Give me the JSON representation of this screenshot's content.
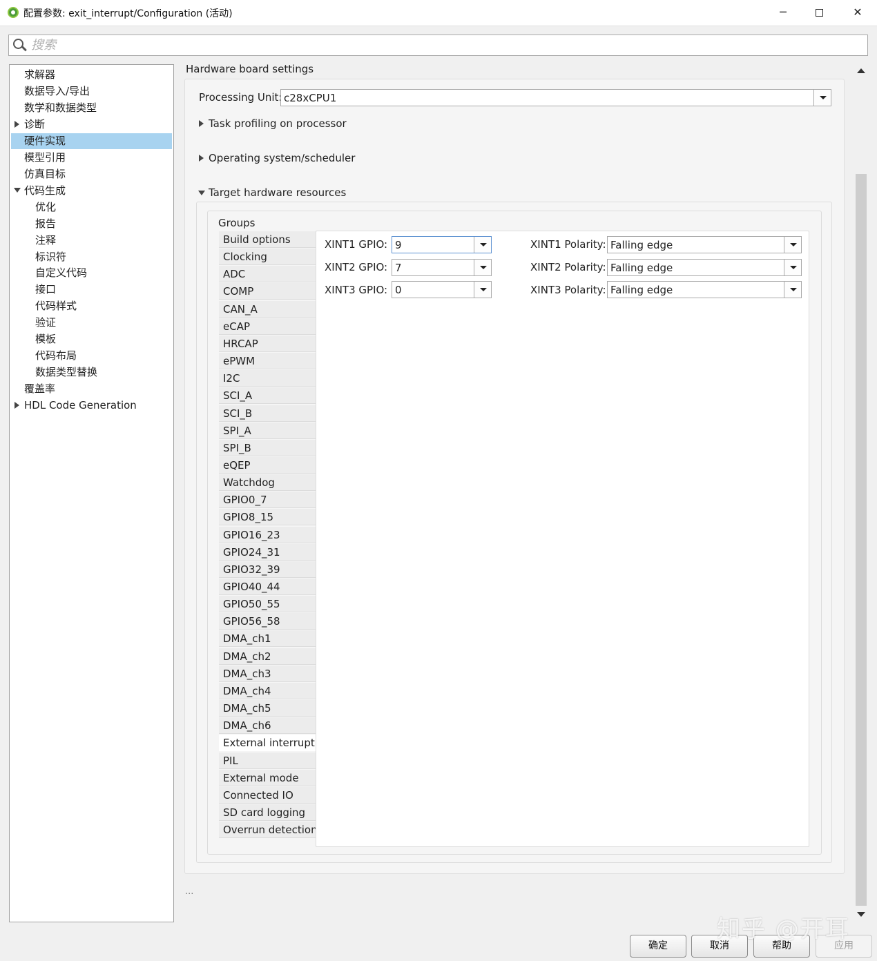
{
  "window": {
    "title": "配置参数: exit_interrupt/Configuration (活动)",
    "minimize": "─",
    "close": "✕"
  },
  "search": {
    "placeholder": "搜索",
    "value": ""
  },
  "tree": {
    "items": [
      {
        "label": "求解器",
        "selected": false
      },
      {
        "label": "数据导入/导出",
        "selected": false
      },
      {
        "label": "数学和数据类型",
        "selected": false
      },
      {
        "label": "诊断",
        "selected": false,
        "expander": "collapsed"
      },
      {
        "label": "硬件实现",
        "selected": true
      },
      {
        "label": "模型引用",
        "selected": false
      },
      {
        "label": "仿真目标",
        "selected": false
      },
      {
        "label": "代码生成",
        "selected": false,
        "expander": "expanded"
      },
      {
        "label": "优化",
        "selected": false
      },
      {
        "label": "报告",
        "selected": false
      },
      {
        "label": "注释",
        "selected": false
      },
      {
        "label": "标识符",
        "selected": false
      },
      {
        "label": "自定义代码",
        "selected": false
      },
      {
        "label": "接口",
        "selected": false
      },
      {
        "label": "代码样式",
        "selected": false
      },
      {
        "label": "验证",
        "selected": false
      },
      {
        "label": "模板",
        "selected": false
      },
      {
        "label": "代码布局",
        "selected": false
      },
      {
        "label": "数据类型替换",
        "selected": false
      },
      {
        "label": "覆盖率",
        "selected": false
      },
      {
        "label": "HDL Code Generation",
        "selected": false,
        "expander": "collapsed"
      }
    ]
  },
  "content": {
    "section_title": "Hardware board settings",
    "processing_unit": {
      "label": "Processing Unit:",
      "value": "c28xCPU1"
    },
    "task_profiling": {
      "label": "Task profiling on processor",
      "state": "collapsed"
    },
    "operating_system": {
      "label": "Operating system/scheduler",
      "state": "collapsed"
    },
    "target_hw": {
      "label": "Target hardware resources",
      "state": "expanded"
    },
    "groups_label": "Groups",
    "groups": [
      "Build options",
      "Clocking",
      "ADC",
      "COMP",
      "CAN_A",
      "eCAP",
      "HRCAP",
      "ePWM",
      "I2C",
      "SCI_A",
      "SCI_B",
      "SPI_A",
      "SPI_B",
      "eQEP",
      "Watchdog",
      "GPIO0_7",
      "GPIO8_15",
      "GPIO16_23",
      "GPIO24_31",
      "GPIO32_39",
      "GPIO40_44",
      "GPIO50_55",
      "GPIO56_58",
      "DMA_ch1",
      "DMA_ch2",
      "DMA_ch3",
      "DMA_ch4",
      "DMA_ch5",
      "DMA_ch6",
      "External interrupt",
      "PIL",
      "External mode",
      "Connected IO",
      "SD card logging",
      "Overrun detection"
    ],
    "selected_group": "External interrupt",
    "external_interrupt": {
      "xint1_gpio": {
        "label": "XINT1 GPIO:",
        "value": "9"
      },
      "xint2_gpio": {
        "label": "XINT2 GPIO:",
        "value": "7"
      },
      "xint3_gpio": {
        "label": "XINT3 GPIO:",
        "value": "0"
      },
      "xint1_polarity": {
        "label": "XINT1 Polarity:",
        "value": "Falling edge"
      },
      "xint2_polarity": {
        "label": "XINT2 Polarity:",
        "value": "Falling edge"
      },
      "xint3_polarity": {
        "label": "XINT3 Polarity:",
        "value": "Falling edge"
      }
    },
    "ellipsis": "..."
  },
  "buttons": {
    "ok": "确定",
    "cancel": "取消",
    "help": "帮助",
    "apply": "应用"
  },
  "watermark": "知乎 @开耳",
  "colors": {
    "selection": "#a8d3f0",
    "app_icon": "#4c9c3a"
  }
}
